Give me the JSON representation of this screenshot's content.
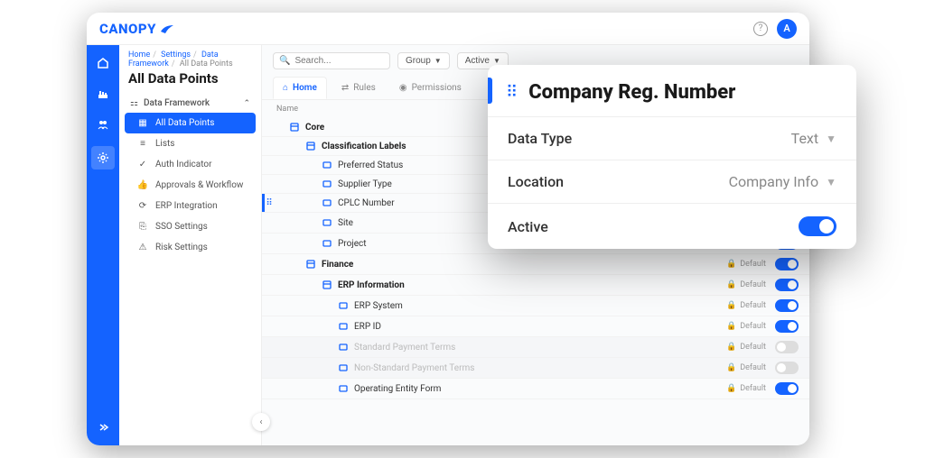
{
  "brand": "CANOPY",
  "topbar": {
    "avatar_initial": "A"
  },
  "breadcrumbs": {
    "home": "Home",
    "settings": "Settings",
    "framework": "Data Framework",
    "current": "All Data Points"
  },
  "page_title": "All Data Points",
  "sidebar": {
    "group_label": "Data Framework",
    "items": [
      {
        "label": "All Data Points",
        "icon": "all-data-points-icon",
        "active": true
      },
      {
        "label": "Lists",
        "icon": "lists-icon"
      },
      {
        "label": "Auth Indicator",
        "icon": "auth-indicator-icon"
      },
      {
        "label": "Approvals & Workflow",
        "icon": "approvals-icon"
      },
      {
        "label": "ERP Integration",
        "icon": "erp-icon"
      },
      {
        "label": "SSO Settings",
        "icon": "sso-icon"
      },
      {
        "label": "Risk Settings",
        "icon": "risk-icon"
      }
    ]
  },
  "toolbar": {
    "search_placeholder": "Search...",
    "group_label": "Group",
    "active_label": "Active"
  },
  "tabs": {
    "home": "Home",
    "rules": "Rules",
    "permissions": "Permissions"
  },
  "column_header": "Name",
  "default_badge": "Default",
  "rows": [
    {
      "label": "Core",
      "depth": 0,
      "bold": true,
      "type": "section"
    },
    {
      "label": "Classification Labels",
      "depth": 1,
      "bold": true,
      "type": "section"
    },
    {
      "label": "Preferred Status",
      "depth": 2,
      "type": "field"
    },
    {
      "label": "Supplier Type",
      "depth": 2,
      "type": "field"
    },
    {
      "label": "CPLC Number",
      "depth": 2,
      "type": "field",
      "highlight": true
    },
    {
      "label": "Site",
      "depth": 2,
      "type": "field",
      "badge": true,
      "toggle": "on"
    },
    {
      "label": "Project",
      "depth": 2,
      "type": "field",
      "badge": true,
      "toggle": "on"
    },
    {
      "label": "Finance",
      "depth": 1,
      "bold": true,
      "type": "section",
      "badge": true,
      "toggle": "on"
    },
    {
      "label": "ERP Information",
      "depth": 2,
      "bold": true,
      "type": "section",
      "badge": true,
      "toggle": "on"
    },
    {
      "label": "ERP System",
      "depth": 3,
      "type": "field",
      "badge": true,
      "toggle": "on"
    },
    {
      "label": "ERP ID",
      "depth": 3,
      "type": "field",
      "badge": true,
      "toggle": "on"
    },
    {
      "label": "Standard Payment Terms",
      "depth": 3,
      "type": "field",
      "muted": true,
      "badge": true,
      "toggle": "off"
    },
    {
      "label": "Non-Standard Payment Terms",
      "depth": 3,
      "type": "field",
      "muted": true,
      "badge": true,
      "toggle": "off"
    },
    {
      "label": "Operating Entity Form",
      "depth": 3,
      "type": "field",
      "badge": true,
      "toggle": "on"
    }
  ],
  "card": {
    "title": "Company Reg. Number",
    "data_type_key": "Data Type",
    "data_type_value": "Text",
    "location_key": "Location",
    "location_value": "Company Info",
    "active_key": "Active"
  }
}
